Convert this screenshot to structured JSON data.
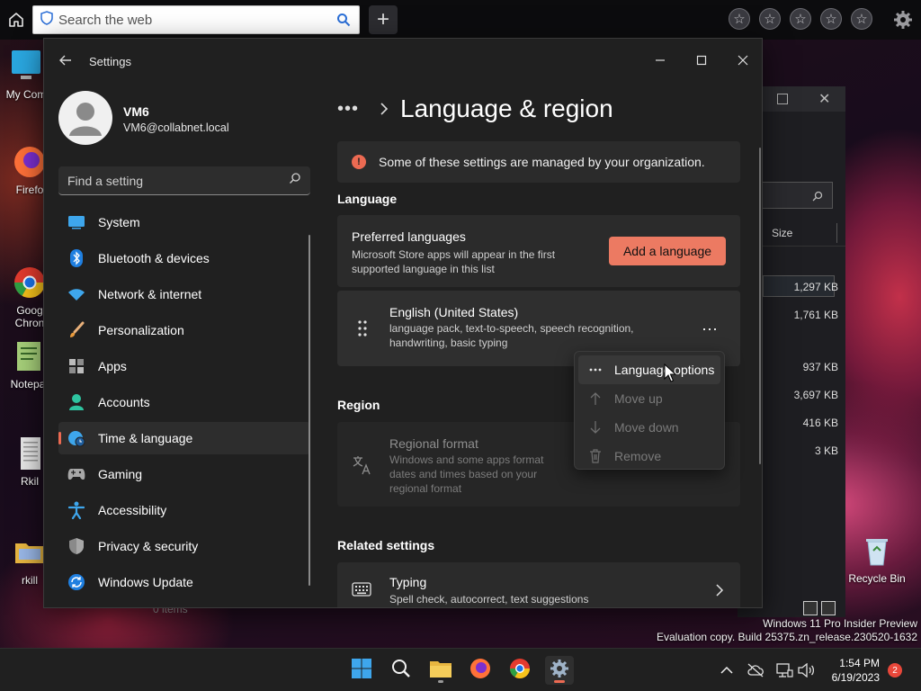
{
  "browser": {
    "search_placeholder": "Search the web",
    "new_tab_label": "+",
    "favorites": [
      "☆",
      "☆",
      "☆",
      "☆",
      "☆"
    ]
  },
  "desktop": {
    "icons": [
      {
        "label": "My Com",
        "icon": "computer-icon"
      },
      {
        "label": "Firefo",
        "icon": "firefox-icon"
      },
      {
        "label": "Goog\nChron",
        "icon": "chrome-icon"
      },
      {
        "label": "Notepa",
        "icon": "notepad-icon"
      },
      {
        "label": "Rkil",
        "icon": "document-icon"
      },
      {
        "label": "rkill",
        "icon": "folder-icon"
      },
      {
        "label": "Recycle Bin",
        "icon": "recycle-bin-icon"
      }
    ]
  },
  "explorer": {
    "size_header": "Size",
    "sizes": [
      "1,297 KB",
      "1,761 KB",
      "937 KB",
      "3,697 KB",
      "416 KB",
      "3 KB"
    ],
    "status": "0 items"
  },
  "settings": {
    "window_title": "Settings",
    "user": {
      "name": "VM6",
      "email": "VM6@collabnet.local"
    },
    "search_placeholder": "Find a setting",
    "nav": [
      {
        "label": "System",
        "icon": "system-icon"
      },
      {
        "label": "Bluetooth & devices",
        "icon": "bluetooth-icon"
      },
      {
        "label": "Network & internet",
        "icon": "wifi-icon"
      },
      {
        "label": "Personalization",
        "icon": "brush-icon"
      },
      {
        "label": "Apps",
        "icon": "apps-icon"
      },
      {
        "label": "Accounts",
        "icon": "accounts-icon"
      },
      {
        "label": "Time & language",
        "icon": "time-language-icon",
        "active": true
      },
      {
        "label": "Gaming",
        "icon": "gaming-icon"
      },
      {
        "label": "Accessibility",
        "icon": "accessibility-icon"
      },
      {
        "label": "Privacy & security",
        "icon": "shield-icon"
      },
      {
        "label": "Windows Update",
        "icon": "update-icon"
      }
    ],
    "page": {
      "breadcrumb_more": "•••",
      "title": "Language & region",
      "notice": "Some of these settings are managed by your organization.",
      "language_section": "Language",
      "preferred": {
        "title": "Preferred languages",
        "subtitle": "Microsoft Store apps will appear in the first supported language in this list",
        "button": "Add a language"
      },
      "language_item": {
        "name": "English (United States)",
        "features": "language pack, text-to-speech, speech recognition, handwriting, basic typing",
        "more": "···"
      },
      "region_section": "Region",
      "regional_format": {
        "title": "Regional format",
        "subtitle": "Windows and some apps format dates and times based on your regional format"
      },
      "related_section": "Related settings",
      "typing": {
        "title": "Typing",
        "subtitle": "Spell check, autocorrect, text suggestions"
      }
    },
    "context_menu": [
      {
        "label": "Language options",
        "icon": "more-icon",
        "enabled": true
      },
      {
        "label": "Move up",
        "icon": "arrow-up-icon",
        "enabled": false
      },
      {
        "label": "Move down",
        "icon": "arrow-down-icon",
        "enabled": false
      },
      {
        "label": "Remove",
        "icon": "trash-icon",
        "enabled": false
      }
    ]
  },
  "watermark": {
    "line1": "Windows 11 Pro Insider Preview",
    "line2": "Evaluation copy. Build 25375.zn_release.230520-1632"
  },
  "taskbar": {
    "time": "1:54 PM",
    "date": "6/19/2023",
    "notification_count": "2"
  },
  "colors": {
    "accent": "#ec6a52",
    "button": "#ec7a62",
    "window_bg": "#202020",
    "card_bg": "#2b2b2b"
  }
}
